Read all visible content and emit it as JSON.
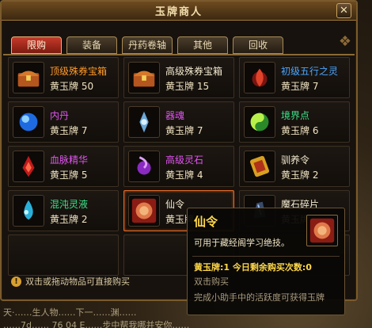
{
  "window": {
    "title": "玉牌商人",
    "close_symbol": "✕"
  },
  "tabs": [
    "限购",
    "装备",
    "丹药卷轴",
    "其他",
    "回收"
  ],
  "active_tab": 0,
  "items": [
    {
      "name": "顶级殊券宝箱",
      "price": "黄玉牌 50",
      "color": "orange",
      "icon": "treasure-chest-icon"
    },
    {
      "name": "高级殊券宝箱",
      "price": "黄玉牌 15",
      "color": "white",
      "icon": "treasure-chest-icon"
    },
    {
      "name": "初级五行之灵",
      "price": "黄玉牌 7",
      "color": "blue",
      "icon": "flame-spirit-icon"
    },
    {
      "name": "内丹",
      "price": "黄玉牌 7",
      "color": "purple",
      "icon": "blue-orb-icon"
    },
    {
      "name": "器魂",
      "price": "黄玉牌 7",
      "color": "purple",
      "icon": "weapon-soul-icon"
    },
    {
      "name": "境界点",
      "price": "黄玉牌 6",
      "color": "green",
      "icon": "yin-yang-icon"
    },
    {
      "name": "血脉精华",
      "price": "黄玉牌 5",
      "color": "purple",
      "icon": "blood-essence-icon"
    },
    {
      "name": "高级灵石",
      "price": "黄玉牌 4",
      "color": "purple",
      "icon": "spirit-stone-icon"
    },
    {
      "name": "驯养令",
      "price": "黄玉牌 2",
      "color": "white",
      "icon": "taming-token-icon"
    },
    {
      "name": "混沌灵液",
      "price": "黄玉牌 2",
      "color": "green",
      "icon": "spirit-liquid-icon"
    },
    {
      "name": "仙令",
      "price": "黄玉牌 1",
      "color": "white",
      "icon": "immortal-token-icon"
    },
    {
      "name": "魔石碎片",
      "price": "黄玉牌",
      "color": "white",
      "icon": "demon-stone-icon"
    }
  ],
  "selected_item": 10,
  "hint": {
    "text": "双击或拖动物品可直接购买",
    "icon": "!"
  },
  "tooltip": {
    "name": "仙令",
    "desc": "可用于藏经阁学习绝技。",
    "price_line": "黄玉牌:1  今日剩余购买次数:0",
    "action": "双击购买",
    "source": "完成小助手中的活跃度可获得玉牌"
  },
  "background_chat": [
    "天·……生人物……下一……渊……",
    "……7d…… 76 04 E……步中帮我哪并安你……"
  ]
}
